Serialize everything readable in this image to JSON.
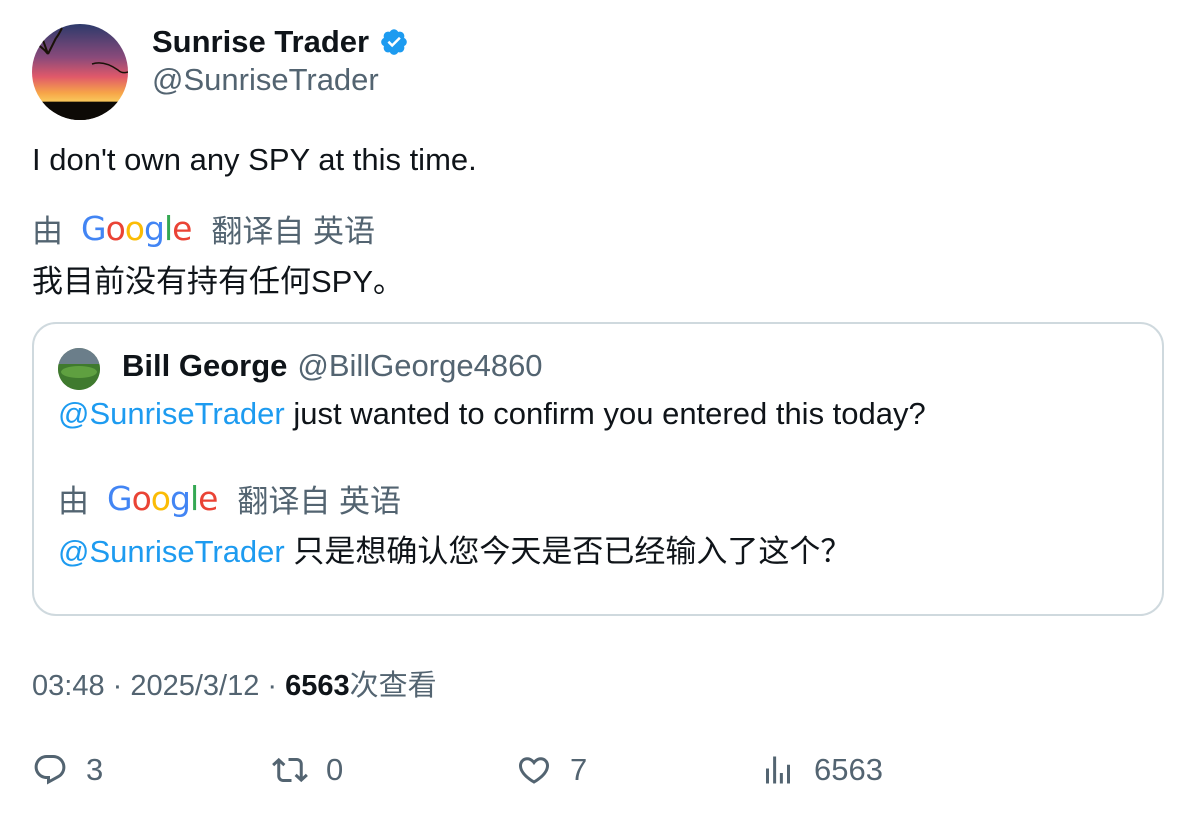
{
  "author": {
    "display_name": "Sunrise Trader",
    "handle": "@SunriseTrader",
    "verified": true
  },
  "tweet": {
    "text": "I don't own any SPY at this time.",
    "translation": {
      "by_label": "由",
      "provider": "Google",
      "from_label": "翻译自 英语",
      "text": "我目前没有持有任何SPY。"
    }
  },
  "quoted": {
    "display_name": "Bill George",
    "handle": "@BillGeorge4860",
    "mention": "@SunriseTrader",
    "text": " just wanted to confirm you entered this today?",
    "translation": {
      "by_label": "由",
      "provider": "Google",
      "from_label": "翻译自 英语",
      "mention": "@SunriseTrader",
      "text": " 只是想确认您今天是否已经输入了这个？"
    }
  },
  "meta": {
    "time": "03:48",
    "separator": " · ",
    "date": "2025/3/12",
    "views_count": "6563",
    "views_label": "次查看"
  },
  "actions": {
    "replies": "3",
    "reposts": "0",
    "likes": "7",
    "views": "6563"
  },
  "colors": {
    "text": "#0f1419",
    "secondary": "#536471",
    "accent": "#1d9bf0",
    "border": "#cfd9de"
  },
  "icons": [
    "verified-badge-icon",
    "reply-icon",
    "repost-icon",
    "like-icon",
    "views-icon"
  ]
}
